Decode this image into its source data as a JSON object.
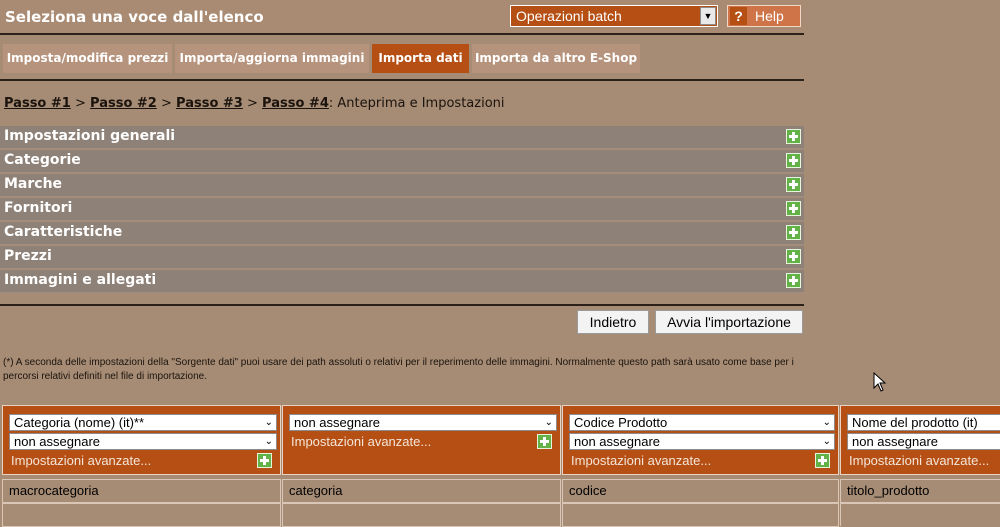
{
  "header": {
    "title": "Seleziona una voce dall'elenco",
    "batch_select": "Operazioni batch",
    "help_label": "Help",
    "help_glyph": "?"
  },
  "tabs": [
    {
      "label": "Imposta/modifica prezzi",
      "active": false
    },
    {
      "label": "Importa/aggiorna immagini",
      "active": false
    },
    {
      "label": "Importa dati",
      "active": true
    },
    {
      "label": "Importa da altro E-Shop",
      "active": false
    }
  ],
  "breadcrumb": {
    "steps": [
      "Passo #1",
      "Passo #2",
      "Passo #3",
      "Passo #4"
    ],
    "separator": ">",
    "current": "Anteprima e Impostazioni"
  },
  "sections": [
    "Impostazioni generali",
    "Categorie",
    "Marche",
    "Fornitori",
    "Caratteristiche",
    "Prezzi",
    "Immagini e allegati"
  ],
  "buttons": {
    "back": "Indietro",
    "start": "Avvia l'importazione"
  },
  "note": "(*) A seconda delle impostazioni della \"Sorgente dati\" puoi usare dei path assoluti o relativi per il reperimento delle immagini. Normalmente questo path sarà usato come base per i percorsi relativi definiti nel file di importazione.",
  "columns": [
    {
      "field": "Categoria (nome) (it)**",
      "mode": "non assegnare",
      "advanced": "Impostazioni avanzate...",
      "value": "macrocategoria"
    },
    {
      "field": "non assegnare",
      "mode": "",
      "advanced": "Impostazioni avanzate...",
      "value": "categoria"
    },
    {
      "field": "Codice Prodotto",
      "mode": "non assegnare",
      "advanced": "Impostazioni avanzate...",
      "value": "codice"
    },
    {
      "field": "Nome del prodotto (it)",
      "mode": "non assegnare",
      "advanced": "Impostazioni avanzate...",
      "value": "titolo_prodotto"
    }
  ],
  "colors": {
    "background": "#a68c75",
    "accent": "#b54f13",
    "section_bar": "#8e8178",
    "plus_green": "#62b248"
  }
}
